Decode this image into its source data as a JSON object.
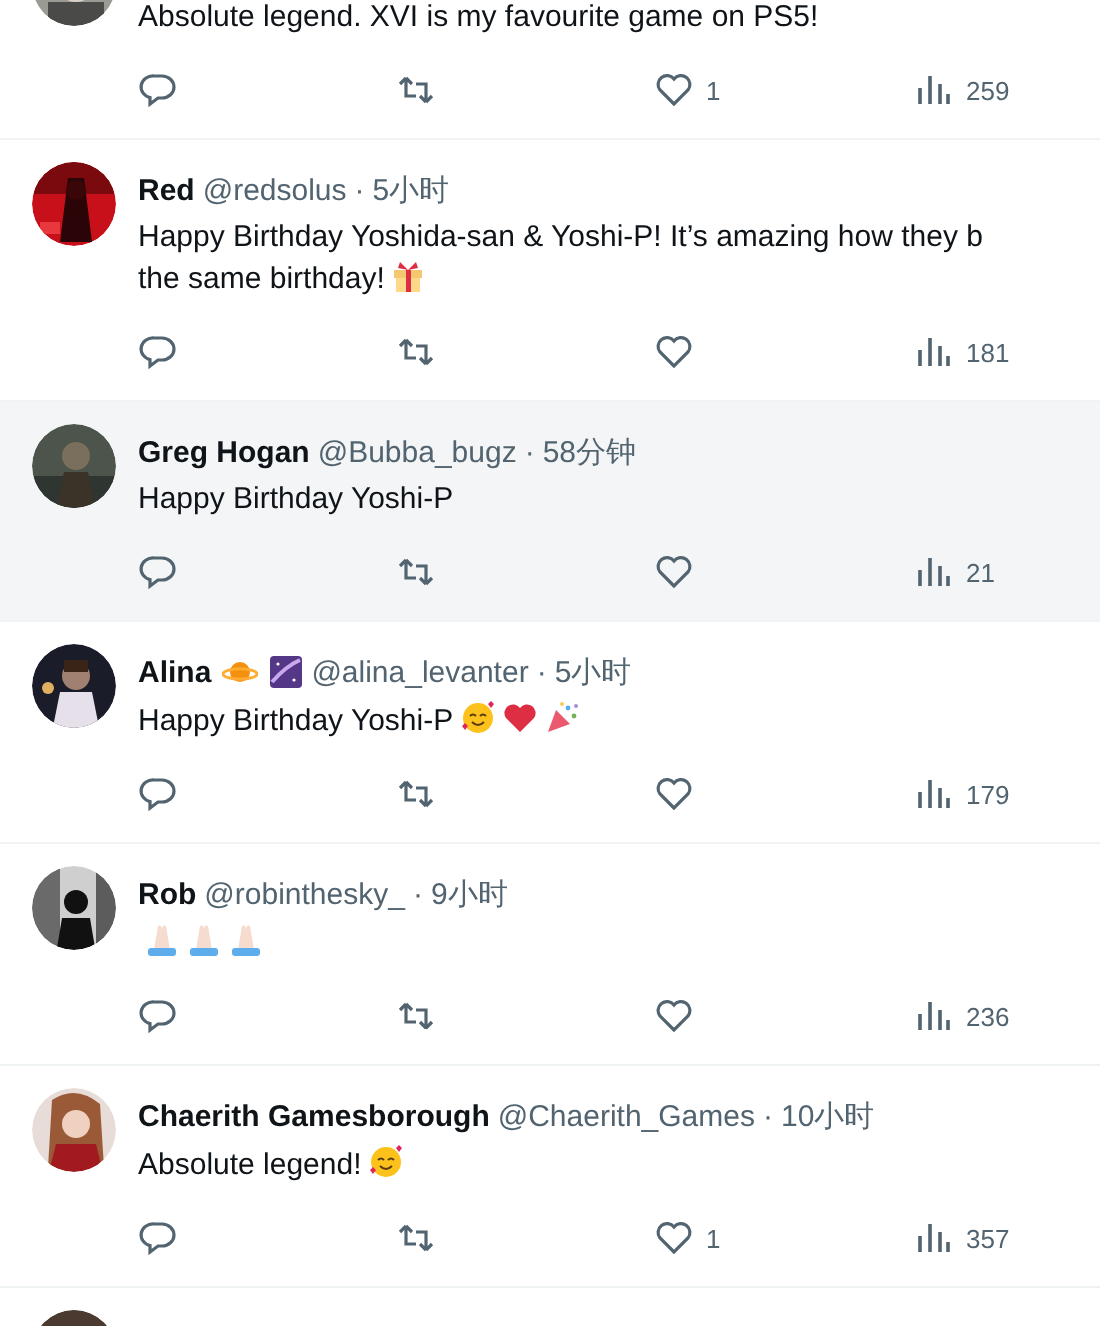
{
  "tweets": [
    {
      "avatar": {
        "kind": "picture"
      },
      "highlighted": false,
      "lines": [
        "Absolute legend. XVI is my favourite game on PS5!"
      ],
      "likes": "1",
      "views": "259"
    },
    {
      "avatar": {
        "kind": "picture"
      },
      "highlighted": false,
      "name": "Red",
      "handle": "@redsolus",
      "dot": "·",
      "time": "5小时",
      "lines": [
        "Happy Birthday Yoshida-san & Yoshi-P! It’s amazing how they b",
        "the same birthday!"
      ],
      "emojis": [
        {
          "kind": "gift"
        }
      ],
      "views": "181"
    },
    {
      "avatar": {
        "kind": "picture"
      },
      "highlighted": true,
      "name": "Greg Hogan",
      "handle": "@Bubba_bugz",
      "dot": "·",
      "time": "58分钟",
      "lines": [
        "Happy Birthday Yoshi-P"
      ],
      "views": "21"
    },
    {
      "avatar": {
        "kind": "picture"
      },
      "highlighted": false,
      "name": "Alina",
      "name_emojis": [
        {
          "kind": "planet"
        },
        {
          "kind": "galaxy"
        }
      ],
      "handle": "@alina_levanter",
      "dot": "·",
      "time": "5小时",
      "lines": [
        "Happy Birthday Yoshi-P"
      ],
      "emojis": [
        {
          "kind": "smile-hearts"
        },
        {
          "kind": "heart"
        },
        {
          "kind": "party"
        }
      ],
      "views": "179"
    },
    {
      "avatar": {
        "kind": "picture"
      },
      "highlighted": false,
      "name": "Rob",
      "handle": "@robinthesky_",
      "dot": "·",
      "time": "9小时",
      "emojis": [
        {
          "kind": "pray"
        },
        {
          "kind": "pray"
        },
        {
          "kind": "pray"
        }
      ],
      "views": "236"
    },
    {
      "avatar": {
        "kind": "picture"
      },
      "highlighted": false,
      "name": "Chaerith Gamesborough",
      "handle": "@Chaerith_Games",
      "dot": "·",
      "time": "10小时",
      "lines": [
        "Absolute legend!"
      ],
      "emojis": [
        {
          "kind": "smile-hearts"
        }
      ],
      "likes": "1",
      "views": "357"
    },
    {
      "avatar": {
        "kind": "picture"
      },
      "highlighted": false
    }
  ]
}
